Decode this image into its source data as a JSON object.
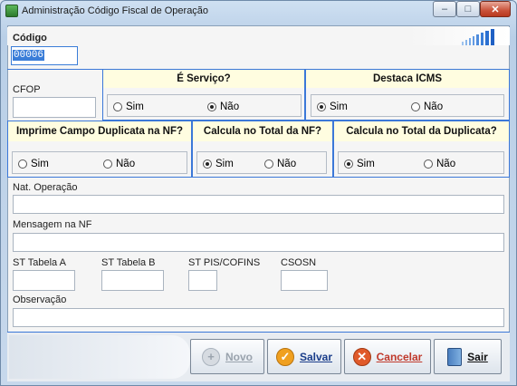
{
  "window": {
    "title": "Administração Código Fiscal de Operação",
    "min": "–",
    "max": "□",
    "close": "✕"
  },
  "codigo": {
    "label": "Código",
    "value": "00006"
  },
  "cfop": {
    "label": "CFOP",
    "value": ""
  },
  "servico": {
    "header": "É Serviço?",
    "opt_sim": "Sim",
    "opt_nao": "Não",
    "selected": "Não"
  },
  "icms": {
    "header": "Destaca ICMS",
    "opt_sim": "Sim",
    "opt_nao": "Não",
    "selected": "Sim"
  },
  "duplicata_nf": {
    "header": "Imprime Campo Duplicata na NF?",
    "opt_sim": "Sim",
    "opt_nao": "Não",
    "selected": "none"
  },
  "total_nf": {
    "header": "Calcula no Total da NF?",
    "opt_sim": "Sim",
    "opt_nao": "Não",
    "selected": "Sim"
  },
  "total_dup": {
    "header": "Calcula no Total da Duplicata?",
    "opt_sim": "Sim",
    "opt_nao": "Não",
    "selected": "Sim"
  },
  "nat_operacao": {
    "label": "Nat. Operação",
    "value": ""
  },
  "mensagem": {
    "label": "Mensagem na NF",
    "value": ""
  },
  "st_a": {
    "label": "ST Tabela A",
    "value": ""
  },
  "st_b": {
    "label": "ST Tabela B",
    "value": ""
  },
  "st_pis": {
    "label": "ST PIS/COFINS",
    "value": ""
  },
  "csosn": {
    "label": "CSOSN",
    "value": ""
  },
  "observacao": {
    "label": "Observação",
    "value": ""
  },
  "buttons": {
    "novo": "Novo",
    "salvar": "Salvar",
    "cancelar": "Cancelar",
    "sair": "Sair"
  },
  "colors": {
    "accent": "#3b78d8",
    "header_bg": "#fffde0",
    "salvar": "#f0a020",
    "cancelar": "#e05a2a"
  }
}
